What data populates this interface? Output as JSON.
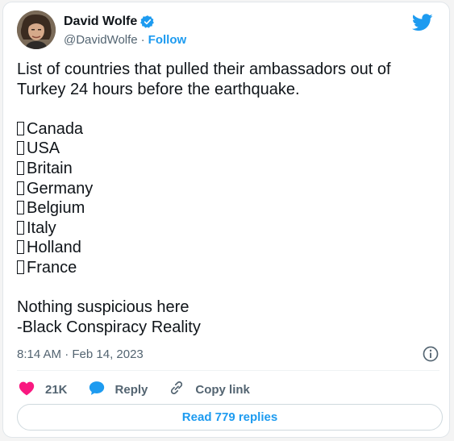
{
  "author": {
    "display_name": "David Wolfe",
    "handle": "@DavidWolfe",
    "separator": "·",
    "follow_label": "Follow"
  },
  "tweet": {
    "intro": "List of countries that pulled their ambassadors out of Turkey 24 hours before the earthquake.",
    "countries": [
      "Canada",
      "USA",
      "Britain",
      "Germany",
      "Belgium",
      "Italy",
      "Holland",
      "France"
    ],
    "closing_line1": "Nothing suspicious here",
    "closing_line2": "-Black Conspiracy Reality",
    "timestamp": "8:14 AM · Feb 14, 2023"
  },
  "actions": {
    "likes": "21K",
    "reply_label": "Reply",
    "copy_link_label": "Copy link"
  },
  "read_replies_label": "Read 779 replies",
  "colors": {
    "brand_blue": "#1d9bf0",
    "like_red": "#f91880",
    "text": "#0f1419",
    "muted": "#536471"
  },
  "icons": {
    "verified": "verified-badge-icon",
    "brand": "twitter-bird-icon",
    "info": "info-icon",
    "like": "heart-icon",
    "reply": "speech-bubble-icon",
    "copy": "link-icon"
  }
}
